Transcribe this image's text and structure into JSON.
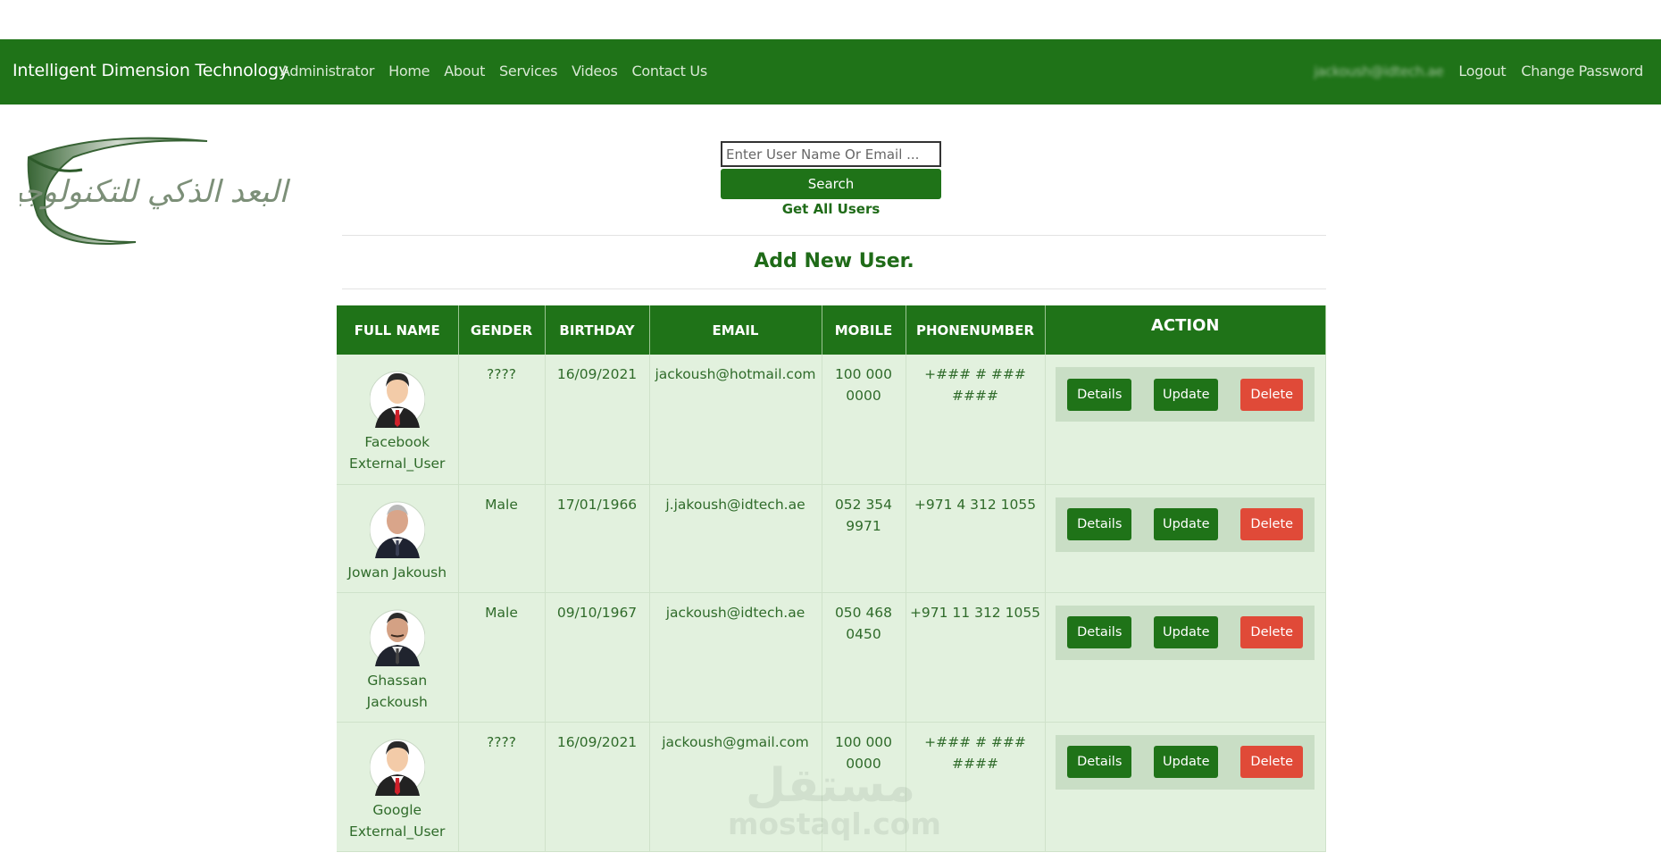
{
  "navbar": {
    "brand": "Intelligent Dimension Technology",
    "links": [
      "Administrator",
      "Home",
      "About",
      "Services",
      "Videos",
      "Contact Us"
    ],
    "user_email": "jackoush@idtech.ae",
    "logout": "Logout",
    "change_password": "Change Password"
  },
  "logo": {
    "text": "البعد الذكي للتكنولوجيا"
  },
  "search": {
    "placeholder": "Enter User Name Or Email ...",
    "button": "Search",
    "get_all": "Get All Users"
  },
  "add_new": "Add New User.",
  "table": {
    "headers": [
      "FULL NAME",
      "GENDER",
      "BIRTHDAY",
      "EMAIL",
      "MOBILE",
      "PHONENUMBER",
      "ACTION"
    ],
    "actions": {
      "details": "Details",
      "update": "Update",
      "delete": "Delete"
    },
    "rows": [
      {
        "name1": "Facebook",
        "name2": "External_User",
        "gender": "????",
        "birthday": "16/09/2021",
        "email": "jackoush@hotmail.com",
        "mobile1": "100 000",
        "mobile2": "0000",
        "phone": "+### # ### ####",
        "avatar": "cartoon-avatar-icon"
      },
      {
        "name1": "Jowan Jakoush",
        "name2": "",
        "gender": "Male",
        "birthday": "17/01/1966",
        "email": "j.jakoush@idtech.ae",
        "mobile1": "052 354",
        "mobile2": "9971",
        "phone": "+971 4 312 1055",
        "avatar": "user-photo"
      },
      {
        "name1": "Ghassan",
        "name2": "Jackoush",
        "gender": "Male",
        "birthday": "09/10/1967",
        "email": "jackoush@idtech.ae",
        "mobile1": "050 468",
        "mobile2": "0450",
        "phone": "+971 11 312 1055",
        "avatar": "user-photo"
      },
      {
        "name1": "Google",
        "name2": "External_User",
        "gender": "????",
        "birthday": "16/09/2021",
        "email": "jackoush@gmail.com",
        "mobile1": "100 000",
        "mobile2": "0000",
        "phone": "+### # ### ####",
        "avatar": "cartoon-avatar-icon"
      }
    ]
  },
  "watermark": {
    "text": "mostaql.com",
    "arabic": "مستقل"
  },
  "colors": {
    "primary": "#1f7318",
    "row_bg": "#e2f1de",
    "danger": "#e04a38"
  }
}
